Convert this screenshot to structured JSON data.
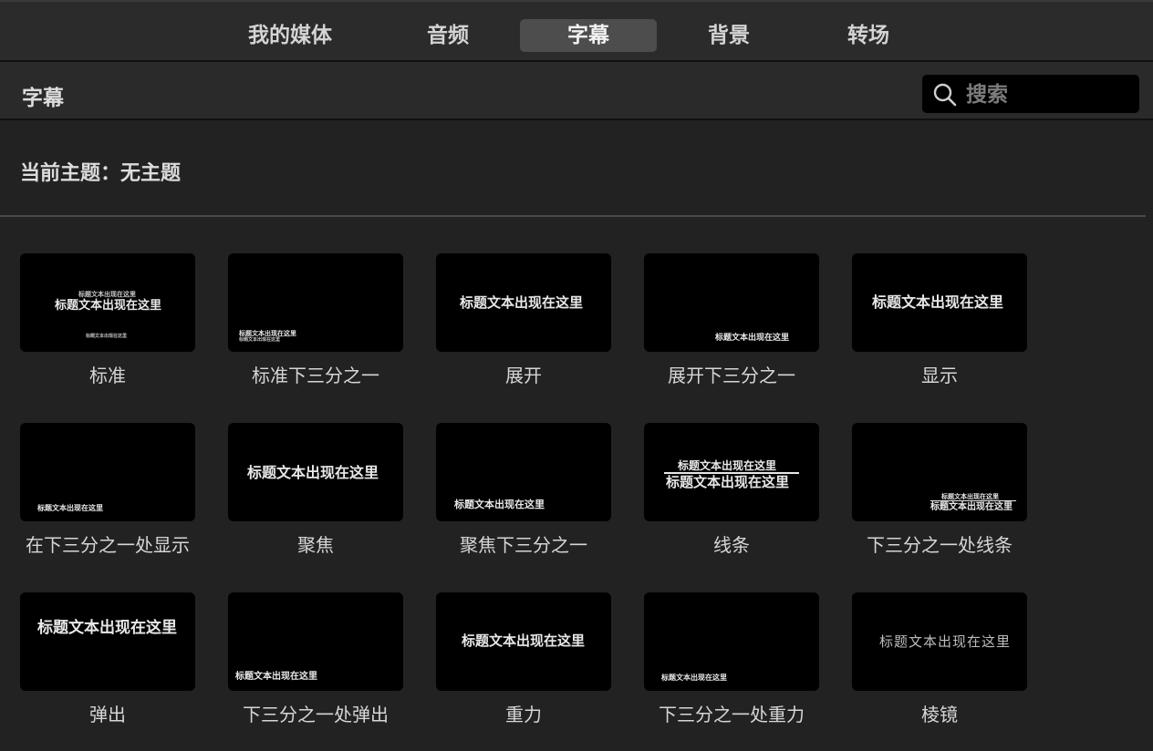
{
  "tabs": [
    {
      "label": "我的媒体",
      "active": false
    },
    {
      "label": "音频",
      "active": false
    },
    {
      "label": "字幕",
      "active": true
    },
    {
      "label": "背景",
      "active": false
    },
    {
      "label": "转场",
      "active": false
    }
  ],
  "header": {
    "title": "字幕",
    "search_placeholder": "搜索"
  },
  "theme_label": "当前主题：无主题",
  "preview_text": "标题文本出现在这里",
  "titles": [
    {
      "label": "标准"
    },
    {
      "label": "标准下三分之一"
    },
    {
      "label": "展开"
    },
    {
      "label": "展开下三分之一"
    },
    {
      "label": "显示"
    },
    {
      "label": "在下三分之一处显示"
    },
    {
      "label": "聚焦"
    },
    {
      "label": "聚焦下三分之一"
    },
    {
      "label": "线条"
    },
    {
      "label": "下三分之一处线条"
    },
    {
      "label": "弹出"
    },
    {
      "label": "下三分之一处弹出"
    },
    {
      "label": "重力"
    },
    {
      "label": "下三分之一处重力"
    },
    {
      "label": "棱镜"
    }
  ]
}
